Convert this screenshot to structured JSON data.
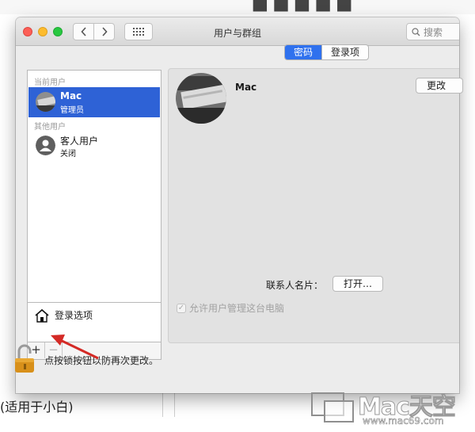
{
  "window": {
    "title": "用户与群组"
  },
  "search": {
    "placeholder": "搜索"
  },
  "sidebar": {
    "current_users_label": "当前用户",
    "current_user": {
      "name": "Mac",
      "role": "管理员"
    },
    "other_users_label": "其他用户",
    "guest_user": {
      "name": "客人用户",
      "status": "关闭"
    },
    "login_options_label": "登录选项",
    "add_symbol": "+",
    "remove_symbol": "−"
  },
  "tabs": {
    "password": "密码",
    "login_items": "登录项",
    "active": "密码"
  },
  "account": {
    "name": "Mac",
    "change_button": "更改"
  },
  "contact_card": {
    "label": "联系人名片：",
    "open_button": "打开…"
  },
  "allow_admin": {
    "label": "允许用户管理这台电脑",
    "checked": true,
    "enabled": false
  },
  "lock": {
    "text": "点按锁按钮以防再次更改。"
  },
  "background": {
    "bottom_text": "(适用于小白)"
  },
  "watermark": {
    "brand": "Mac天空",
    "url": "www.mac69.com"
  },
  "colors": {
    "selection": "#2e62d6",
    "segment_active": "#2f71ee",
    "annotation_arrow": "#d42a26",
    "lock_body": "#d8901a"
  },
  "icons": {
    "back": "chevron-left-icon",
    "forward": "chevron-right-icon",
    "show_all": "grid-icon",
    "search": "search-icon",
    "home": "house-icon",
    "lock": "unlocked-padlock-icon"
  }
}
